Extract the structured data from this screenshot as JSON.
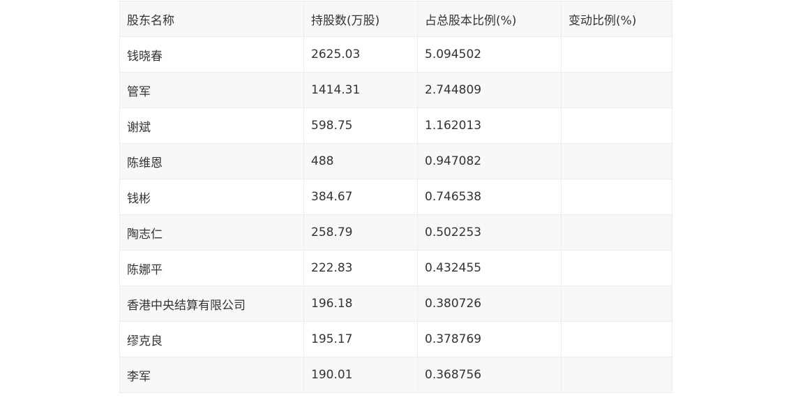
{
  "table": {
    "headers": [
      "股东名称",
      "持股数(万股)",
      "占总股本比例(%)",
      "变动比例(%)"
    ],
    "rows": [
      [
        "钱晓春",
        "2625.03",
        "5.094502",
        ""
      ],
      [
        "管军",
        "1414.31",
        "2.744809",
        ""
      ],
      [
        "谢斌",
        "598.75",
        "1.162013",
        ""
      ],
      [
        "陈维恩",
        "488",
        "0.947082",
        ""
      ],
      [
        "钱彬",
        "384.67",
        "0.746538",
        ""
      ],
      [
        "陶志仁",
        "258.79",
        "0.502253",
        ""
      ],
      [
        "陈娜平",
        "222.83",
        "0.432455",
        ""
      ],
      [
        "香港中央结算有限公司",
        "196.18",
        "0.380726",
        ""
      ],
      [
        "缪克良",
        "195.17",
        "0.378769",
        ""
      ],
      [
        "李军",
        "190.01",
        "0.368756",
        ""
      ]
    ]
  }
}
